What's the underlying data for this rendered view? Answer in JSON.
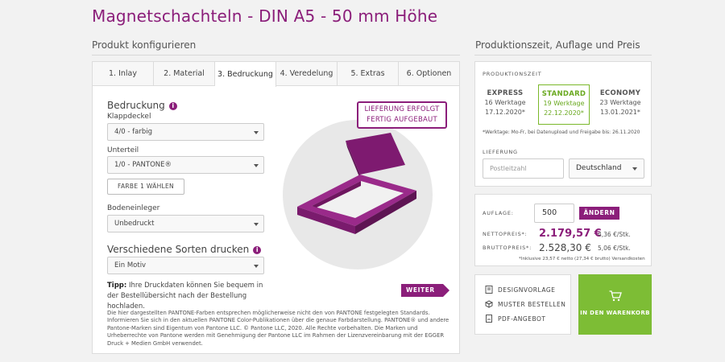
{
  "page": {
    "title": "Magnetschachteln - DIN A5 - 50 mm Höhe"
  },
  "left": {
    "section_title": "Produkt konfigurieren",
    "tabs": [
      {
        "label": "1. Inlay",
        "active": false
      },
      {
        "label": "2. Material",
        "active": false
      },
      {
        "label": "3. Bedruckung",
        "active": true
      },
      {
        "label": "4. Veredelung",
        "active": false
      },
      {
        "label": "5. Extras",
        "active": false
      },
      {
        "label": "6. Optionen",
        "active": false
      }
    ],
    "bedruckung": {
      "heading": "Bedruckung",
      "klappdeckel_label": "Klappdeckel",
      "klappdeckel_value": "4/0 - farbig",
      "unterteil_label": "Unterteil",
      "unterteil_value": "1/0 - PANTONE®",
      "color_button": "FARBE 1 WÄHLEN",
      "bodeneinleger_label": "Bodeneinleger",
      "bodeneinleger_value": "Unbedruckt"
    },
    "sorten": {
      "heading": "Verschiedene Sorten drucken",
      "value": "Ein Motiv"
    },
    "badge_line1": "LIEFERUNG ERFOLGT",
    "badge_line2": "FERTIG AUFGEBAUT",
    "tip_bold": "Tipp:",
    "tip_text": " Ihre Druckdaten können Sie bequem in der Bestellübersicht nach der Bestellung hochladen.",
    "weiter": "WEITER",
    "disclaimer": "Die hier dargestellten PANTONE-Farben entsprechen möglicherweise nicht den von PANTONE festgelegten Standards. Informieren Sie sich in den aktuellen PANTONE Color-Publikationen über die genaue Farbdarstellung. PANTONE® und andere Pantone-Marken sind Eigentum von Pantone LLC. © Pantone LLC, 2020. Alle Rechte vorbehalten. Die Marken und Urheberrechte von Pantone werden mit Genehmigung der Pantone LLC im Rahmen der Lizenzvereinbarung mit der EGGER Druck + Medien GmbH verwendet."
  },
  "right": {
    "section_title": "Produktionszeit, Auflage und Preis",
    "production_label": "PRODUKTIONSZEIT",
    "options": [
      {
        "title": "EXPRESS",
        "days": "16 Werktage",
        "date": "17.12.2020*",
        "selected": false
      },
      {
        "title": "STANDARD",
        "days": "19 Werktage",
        "date": "22.12.2020*",
        "selected": true
      },
      {
        "title": "ECONOMY",
        "days": "23 Werktage",
        "date": "13.01.2021*",
        "selected": false
      }
    ],
    "workday_note": "*Werktage: Mo-Fr, bei Datenupload und Freigabe bis: 26.11.2020",
    "delivery_label": "LIEFERUNG",
    "zip_placeholder": "Postleitzahl",
    "country": "Deutschland",
    "quantity_label": "AUFLAGE:",
    "quantity": "500",
    "change_button": "ÄNDERN",
    "net_label": "NETTOPREIS*:",
    "net_price": "2.179,57 €",
    "net_unit": "4,36 €/Stk.",
    "gross_label": "BRUTTOPREIS*:",
    "gross_price": "2.528,30 €",
    "gross_unit": "5,06 €/Stk.",
    "vat_note": "*Inklusive 23,57 € netto (27,34 € brutto) Versandkosten",
    "links": [
      "DESIGNVORLAGE",
      "MUSTER BESTELLEN",
      "PDF-ANGEBOT"
    ],
    "cart_button": "IN DEN WARENKORB"
  },
  "colors": {
    "brand": "#8b1e7a",
    "accent_green": "#7dbd35",
    "background": "#f2f2f2"
  },
  "icons": [
    "info-icon",
    "caret-down-icon",
    "document-icon",
    "box-icon",
    "pdf-icon",
    "cart-icon",
    "arrow-right-icon"
  ]
}
